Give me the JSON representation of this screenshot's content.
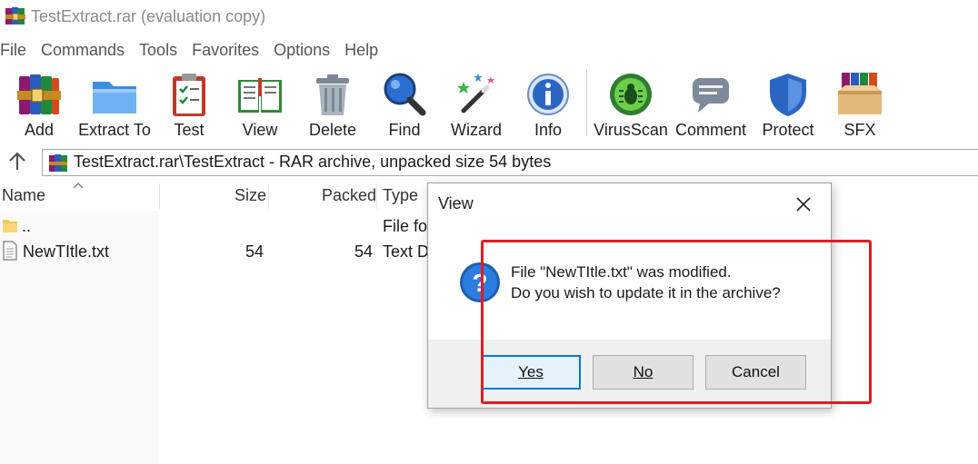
{
  "window": {
    "title": "TestExtract.rar (evaluation copy)"
  },
  "menu": [
    "File",
    "Commands",
    "Tools",
    "Favorites",
    "Options",
    "Help"
  ],
  "toolbar": [
    {
      "label": "Add",
      "icon": "add-books-icon"
    },
    {
      "label": "Extract To",
      "icon": "extract-folder-icon"
    },
    {
      "label": "Test",
      "icon": "test-clipboard-icon"
    },
    {
      "label": "View",
      "icon": "view-book-icon"
    },
    {
      "label": "Delete",
      "icon": "trash-icon"
    },
    {
      "label": "Find",
      "icon": "magnifier-icon"
    },
    {
      "label": "Wizard",
      "icon": "wand-icon"
    },
    {
      "label": "Info",
      "icon": "info-icon"
    },
    {
      "label": "VirusScan",
      "icon": "virus-scan-icon"
    },
    {
      "label": "Comment",
      "icon": "comment-icon"
    },
    {
      "label": "Protect",
      "icon": "shield-icon"
    },
    {
      "label": "SFX",
      "icon": "sfx-box-icon"
    }
  ],
  "address": {
    "text": "TestExtract.rar\\TestExtract - RAR archive, unpacked size 54 bytes"
  },
  "columns": {
    "name": "Name",
    "size": "Size",
    "packed": "Packed",
    "type": "Type"
  },
  "rows": [
    {
      "name": "..",
      "size": "",
      "packed": "",
      "type": "File fo"
    },
    {
      "name": "NewTItle.txt",
      "size": "54",
      "packed": "54",
      "type": "Text D"
    }
  ],
  "dialog": {
    "title": "View",
    "message_line1": "File \"NewTItle.txt\" was modified.",
    "message_line2": "Do you wish to update it in the archive?",
    "yes": "Yes",
    "no": "No",
    "cancel": "Cancel"
  },
  "colors": {
    "annotation": "#e01c24",
    "accent": "#0078d7"
  }
}
